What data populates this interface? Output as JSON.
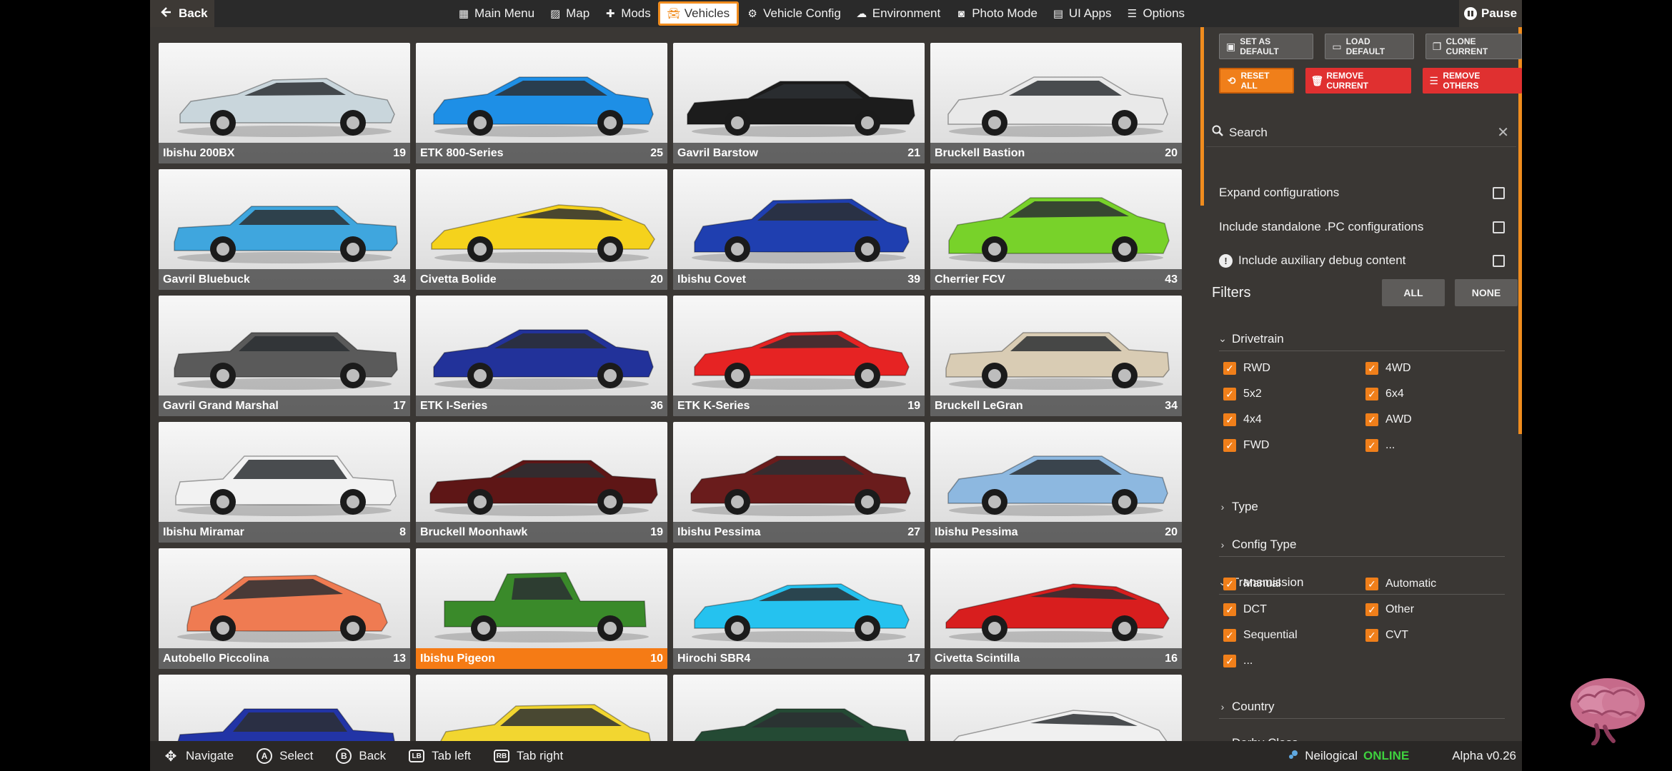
{
  "topbar": {
    "back_label": "Back",
    "pause_label": "Pause",
    "menu": [
      {
        "label": "Main Menu",
        "icon": "grid-icon"
      },
      {
        "label": "Map",
        "icon": "map-icon"
      },
      {
        "label": "Mods",
        "icon": "puzzle-icon"
      },
      {
        "label": "Vehicles",
        "icon": "car-icon",
        "active": true
      },
      {
        "label": "Vehicle Config",
        "icon": "wrench-car-icon"
      },
      {
        "label": "Environment",
        "icon": "weather-icon"
      },
      {
        "label": "Photo Mode",
        "icon": "camera-icon"
      },
      {
        "label": "UI Apps",
        "icon": "apps-icon"
      },
      {
        "label": "Options",
        "icon": "sliders-icon"
      }
    ]
  },
  "vehicles": [
    {
      "name": "Ibishu 200BX",
      "count": "19",
      "color": "#c9d6dc",
      "shape": "coupe"
    },
    {
      "name": "ETK 800-Series",
      "count": "25",
      "color": "#1e8fe6",
      "shape": "sedan"
    },
    {
      "name": "Gavril Barstow",
      "count": "21",
      "color": "#1c1c1c",
      "shape": "muscle"
    },
    {
      "name": "Bruckell Bastion",
      "count": "20",
      "color": "#e9e9e9",
      "shape": "sedan"
    },
    {
      "name": "Gavril Bluebuck",
      "count": "34",
      "color": "#3fa6de",
      "shape": "boxy"
    },
    {
      "name": "Civetta Bolide",
      "count": "20",
      "color": "#f5d21c",
      "shape": "wedge"
    },
    {
      "name": "Ibishu Covet",
      "count": "39",
      "color": "#1f3fb0",
      "shape": "hatch"
    },
    {
      "name": "Cherrier FCV",
      "count": "43",
      "color": "#78d22a",
      "shape": "suv"
    },
    {
      "name": "Gavril Grand Marshal",
      "count": "17",
      "color": "#5a5a5a",
      "shape": "boxy"
    },
    {
      "name": "ETK I-Series",
      "count": "36",
      "color": "#22329a",
      "shape": "sedan"
    },
    {
      "name": "ETK K-Series",
      "count": "19",
      "color": "#e62323",
      "shape": "coupe"
    },
    {
      "name": "Bruckell LeGran",
      "count": "34",
      "color": "#d9ccb4",
      "shape": "boxy"
    },
    {
      "name": "Ibishu Miramar",
      "count": "8",
      "color": "#f2f2f2",
      "shape": "classic"
    },
    {
      "name": "Bruckell Moonhawk",
      "count": "19",
      "color": "#5e1616",
      "shape": "muscle"
    },
    {
      "name": "Ibishu Pessima",
      "count": "27",
      "color": "#6a1c1c",
      "shape": "sedan"
    },
    {
      "name": "Ibishu Pessima",
      "count": "20",
      "color": "#8db8e0",
      "shape": "sedan"
    },
    {
      "name": "Autobello Piccolina",
      "count": "13",
      "color": "#ef7b52",
      "shape": "bubble"
    },
    {
      "name": "Ibishu Pigeon",
      "count": "10",
      "color": "#3a8a2a",
      "shape": "pickup",
      "selected": true
    },
    {
      "name": "Hirochi SBR4",
      "count": "17",
      "color": "#25c2ef",
      "shape": "coupe"
    },
    {
      "name": "Civetta Scintilla",
      "count": "16",
      "color": "#d81e1e",
      "shape": "wedge"
    },
    {
      "name": "",
      "count": "",
      "color": "#2234a6",
      "shape": "classic"
    },
    {
      "name": "",
      "count": "",
      "color": "#f2d630",
      "shape": "hatch"
    },
    {
      "name": "",
      "count": "",
      "color": "#244a34",
      "shape": "sedan"
    },
    {
      "name": "",
      "count": "",
      "color": "#f0f0f0",
      "shape": "wedge"
    }
  ],
  "panel": {
    "buttons_row1": [
      {
        "label": "SET AS DEFAULT",
        "icon": "save-icon"
      },
      {
        "label": "LOAD DEFAULT",
        "icon": "folder-icon"
      },
      {
        "label": "CLONE CURRENT",
        "icon": "clone-icon"
      }
    ],
    "buttons_row2": [
      {
        "label": "RESET ALL",
        "icon": "reset-icon",
        "style": "orange"
      },
      {
        "label": "REMOVE CURRENT",
        "icon": "trash-icon",
        "style": "red"
      },
      {
        "label": "REMOVE OTHERS",
        "icon": "trash-list-icon",
        "style": "red"
      }
    ],
    "search_placeholder": "Search",
    "options": [
      {
        "label": "Expand configurations",
        "checked": false
      },
      {
        "label": "Include standalone .PC configurations",
        "checked": false
      },
      {
        "label": "Include auxiliary debug content",
        "checked": false,
        "info": true
      }
    ],
    "filters_title": "Filters",
    "all_label": "ALL",
    "none_label": "NONE",
    "drivetrain": {
      "title": "Drivetrain",
      "items": [
        "RWD",
        "4WD",
        "5x2",
        "6x4",
        "4x4",
        "AWD",
        "FWD",
        "..."
      ]
    },
    "type_title": "Type",
    "config_type_title": "Config Type",
    "transmission": {
      "title": "Transmission",
      "items": [
        "Manual",
        "Automatic",
        "DCT",
        "Other",
        "Sequential",
        "CVT",
        "..."
      ]
    },
    "country_title": "Country",
    "derby_title": "Derby Class"
  },
  "bottombar": {
    "hints": [
      {
        "btn": "✥",
        "label": "Navigate",
        "shape": "dpad"
      },
      {
        "btn": "A",
        "label": "Select",
        "shape": "circle"
      },
      {
        "btn": "B",
        "label": "Back",
        "shape": "circle"
      },
      {
        "btn": "LB",
        "label": "Tab left",
        "shape": "square"
      },
      {
        "btn": "RB",
        "label": "Tab right",
        "shape": "square"
      }
    ],
    "username": "Neilogical",
    "online": "ONLINE",
    "version": "Alpha v0.26"
  },
  "colors": {
    "accent": "#f08c1e",
    "danger": "#e03030",
    "online": "#3ed13e"
  }
}
